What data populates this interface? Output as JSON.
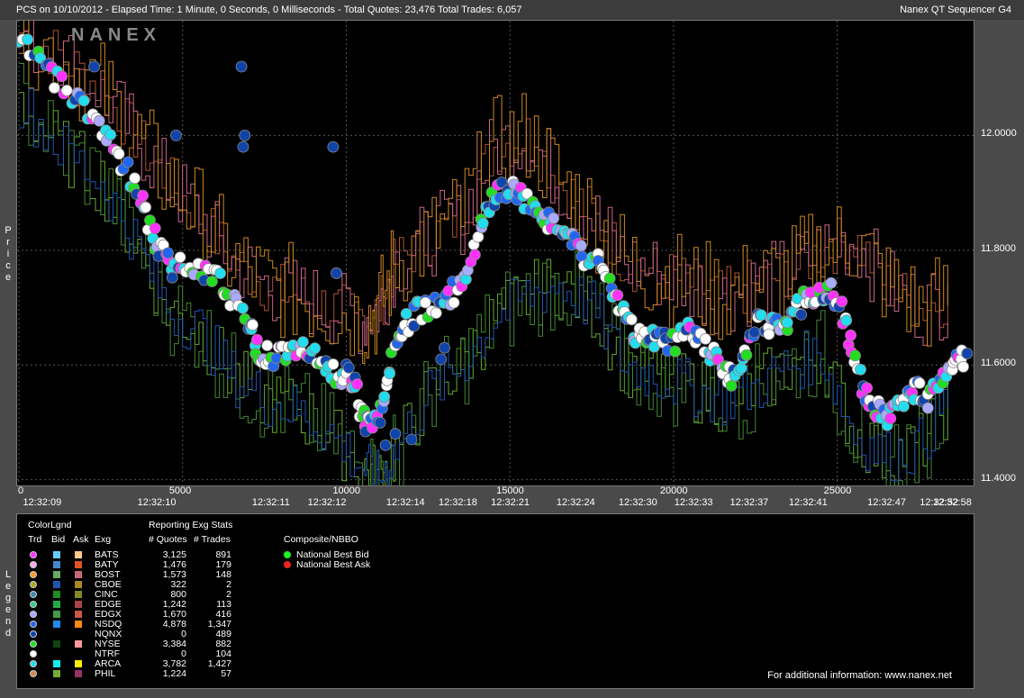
{
  "window": {
    "title_left": "PCS on 10/10/2012  -  Elapsed Time: 1 Minute, 0 Seconds, 0 Milliseconds  -  Total Quotes: 23,476  Total Trades: 6,057",
    "title_right": "Nanex QT Sequencer G4",
    "watermark": "NANEX"
  },
  "side_labels": {
    "price": "Price",
    "legend": "Legend"
  },
  "chart_data": {
    "type": "scatter",
    "title": "PCS on 10/10/2012",
    "ylabel": "Price",
    "ylim": [
      11.39,
      12.2
    ],
    "xlim": [
      0,
      29000
    ],
    "y_ticks": [
      "12.0000",
      "11.8000",
      "11.6000",
      "11.4000"
    ],
    "y_tick_values": [
      12.0,
      11.8,
      11.6,
      11.4
    ],
    "x_ticks": [
      "0",
      "5000",
      "10000",
      "15000",
      "20000",
      "25000"
    ],
    "x_tick_values": [
      0,
      5000,
      10000,
      15000,
      20000,
      25000
    ],
    "time_labels": [
      "12:32:09",
      "12:32:10",
      "12:32:11",
      "12:32:12",
      "12:32:14",
      "12:32:18",
      "12:32:21",
      "12:32:24",
      "12:32:30",
      "12:32:33",
      "12:32:37",
      "12:32:41",
      "12:32:47",
      "12:32:52",
      "12:32:58"
    ],
    "time_label_x": [
      700,
      4200,
      7700,
      9400,
      11800,
      13400,
      15000,
      17000,
      18900,
      20600,
      22300,
      24100,
      26500,
      28100,
      29600
    ],
    "grid": true,
    "nbbo_path": {
      "x": [
        0,
        800,
        1500,
        2200,
        2800,
        3400,
        3900,
        4300,
        4700,
        5200,
        5800,
        6400,
        7000,
        7300,
        7700,
        8200,
        8700,
        9200,
        9700,
        10100,
        10400,
        10700,
        11000,
        11300,
        11700,
        12100,
        12600,
        13100,
        13600,
        14100,
        14500,
        15000,
        15400,
        15900,
        16300,
        16800,
        17300,
        17800,
        18300,
        18700,
        19100,
        19500,
        20000,
        20500,
        21000,
        21400,
        21800,
        22200,
        22600,
        23000,
        23400,
        23800,
        24200,
        24600,
        25000,
        25400,
        25800,
        26200,
        26600,
        27000,
        27400,
        27800,
        28200,
        28600,
        29000
      ],
      "y": [
        12.16,
        12.12,
        12.08,
        12.04,
        11.99,
        11.93,
        11.86,
        11.8,
        11.77,
        11.78,
        11.76,
        11.73,
        11.68,
        11.63,
        11.61,
        11.63,
        11.64,
        11.6,
        11.58,
        11.6,
        11.53,
        11.49,
        11.51,
        11.58,
        11.66,
        11.69,
        11.7,
        11.72,
        11.74,
        11.83,
        11.89,
        11.91,
        11.89,
        11.87,
        11.84,
        11.82,
        11.79,
        11.77,
        11.71,
        11.66,
        11.64,
        11.65,
        11.64,
        11.66,
        11.63,
        11.61,
        11.57,
        11.63,
        11.68,
        11.67,
        11.66,
        11.7,
        11.72,
        11.73,
        11.72,
        11.64,
        11.55,
        11.52,
        11.51,
        11.53,
        11.56,
        11.54,
        11.58,
        11.61,
        11.61
      ]
    },
    "outlier_trades": {
      "x": [
        2300,
        4800,
        6800,
        6900,
        6850,
        9600,
        9700,
        11200,
        11500,
        12000,
        12900,
        13000
      ],
      "y": [
        12.12,
        12.0,
        12.12,
        12.0,
        11.98,
        11.98,
        11.76,
        11.46,
        11.48,
        11.47,
        11.61,
        11.63
      ]
    },
    "bid_path": {
      "x": [
        0,
        1200,
        2500,
        3500,
        4500,
        5500,
        6500,
        7500,
        8500,
        9500,
        10500,
        11000,
        11500,
        12500,
        13500,
        14500,
        15500,
        16500,
        17500,
        18500,
        19500,
        20500,
        21500,
        22500,
        23500,
        24500,
        25500,
        26500,
        27500,
        28500
      ],
      "y": [
        12.06,
        11.98,
        11.92,
        11.82,
        11.7,
        11.66,
        11.58,
        11.54,
        11.52,
        11.48,
        11.42,
        11.4,
        11.45,
        11.55,
        11.6,
        11.68,
        11.72,
        11.74,
        11.7,
        11.6,
        11.58,
        11.56,
        11.54,
        11.56,
        11.6,
        11.62,
        11.48,
        11.44,
        11.46,
        11.55
      ]
    },
    "ask_path": {
      "x": [
        0,
        1200,
        2500,
        3500,
        4500,
        5500,
        6500,
        7500,
        8500,
        9500,
        10500,
        11000,
        11500,
        12500,
        13500,
        14500,
        15500,
        16500,
        17500,
        18500,
        19500,
        20500,
        21500,
        22500,
        23500,
        24500,
        25500,
        26500,
        27500,
        28500
      ],
      "y": [
        12.18,
        12.14,
        12.08,
        12.0,
        11.92,
        11.86,
        11.78,
        11.74,
        11.72,
        11.7,
        11.68,
        11.7,
        11.78,
        11.82,
        11.86,
        11.98,
        12.0,
        11.92,
        11.86,
        11.78,
        11.76,
        11.74,
        11.72,
        11.74,
        11.76,
        11.8,
        11.82,
        11.74,
        11.7,
        11.72
      ]
    }
  },
  "legend": {
    "headers": {
      "colorlgnd": "ColorLgnd",
      "trd": "Trd",
      "bid": "Bid",
      "ask": "Ask",
      "exg": "Exg",
      "stats": "Reporting Exg Stats",
      "quotes": "# Quotes",
      "trades": "# Trades",
      "composite": "Composite/NBBO"
    },
    "rows": [
      {
        "exg": "BATS",
        "quotes": "3,125",
        "trades": "891",
        "trd": "#ff33ff",
        "bid": "#66ccff",
        "ask": "#ffcc88"
      },
      {
        "exg": "BATY",
        "quotes": "1,476",
        "trades": "179",
        "trd": "#ffaaee",
        "bid": "#4488cc",
        "ask": "#dd5522"
      },
      {
        "exg": "BOST",
        "quotes": "1,573",
        "trades": "148",
        "trd": "#ff9933",
        "bid": "#66aa66",
        "ask": "#cc6677"
      },
      {
        "exg": "CBOE",
        "quotes": "322",
        "trades": "2",
        "trd": "#aaaa22",
        "bid": "#2255aa",
        "ask": "#aa8822"
      },
      {
        "exg": "CINC",
        "quotes": "800",
        "trades": "2",
        "trd": "#4488aa",
        "bid": "#228822",
        "ask": "#888822"
      },
      {
        "exg": "EDGE",
        "quotes": "1,242",
        "trades": "113",
        "trd": "#33cc88",
        "bid": "#22aa44",
        "ask": "#aa4444"
      },
      {
        "exg": "EDGX",
        "quotes": "1,670",
        "trades": "416",
        "trd": "#aaaaff",
        "bid": "#449944",
        "ask": "#cc5544"
      },
      {
        "exg": "NSDQ",
        "quotes": "4,878",
        "trades": "1,347",
        "trd": "#2266ee",
        "bid": "#2288ee",
        "ask": "#ff8811"
      },
      {
        "exg": "NQNX",
        "quotes": "0",
        "trades": "489",
        "trd": "#1144aa",
        "bid": "",
        "ask": ""
      },
      {
        "exg": "NYSE",
        "quotes": "3,384",
        "trades": "882",
        "trd": "#22dd22",
        "bid": "#114411",
        "ask": "#ff9999"
      },
      {
        "exg": "NTRF",
        "quotes": "0",
        "trades": "104",
        "trd": "#ffffff",
        "bid": "",
        "ask": ""
      },
      {
        "exg": "ARCA",
        "quotes": "3,782",
        "trades": "1,427",
        "trd": "#22ddee",
        "bid": "#11eeee",
        "ask": "#ffee00"
      },
      {
        "exg": "PHIL",
        "quotes": "1,224",
        "trades": "57",
        "trd": "#cc8855",
        "bid": "#77aa33",
        "ask": "#993366"
      }
    ],
    "composite": [
      {
        "label": "National Best Bid",
        "color": "#22ee22"
      },
      {
        "label": "National Best Ask",
        "color": "#ee2222"
      }
    ],
    "footer": "For additional information: www.nanex.net"
  }
}
